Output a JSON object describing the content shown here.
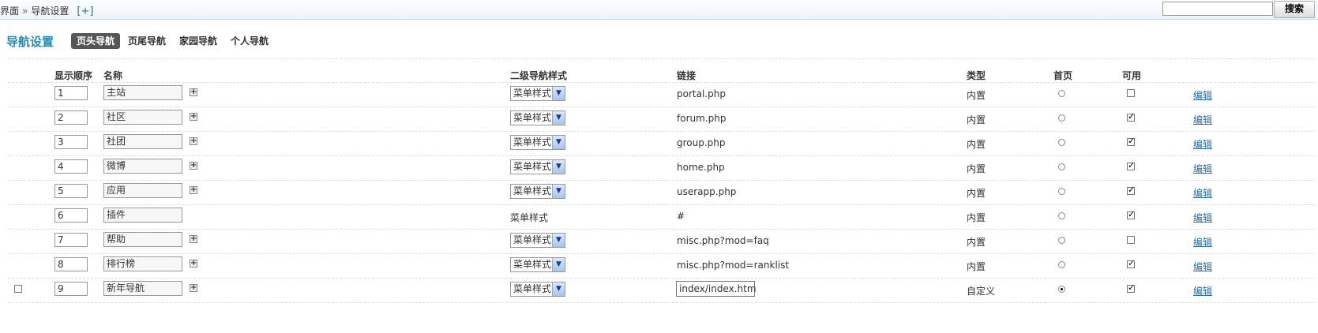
{
  "breadcrumb": {
    "root": "界面",
    "separator": "»",
    "current": "导航设置",
    "add": "[+]"
  },
  "search": {
    "value": "",
    "button": "搜索"
  },
  "page_title": "导航设置",
  "tabs": [
    {
      "label": "页头导航",
      "active": true
    },
    {
      "label": "页尾导航",
      "active": false
    },
    {
      "label": "家园导航",
      "active": false
    },
    {
      "label": "个人导航",
      "active": false
    }
  ],
  "columns": {
    "order": "显示顺序",
    "name": "名称",
    "sub_style": "二级导航样式",
    "link": "链接",
    "type": "类型",
    "home": "首页",
    "available": "可用"
  },
  "rows": [
    {
      "order": "1",
      "name": "主站",
      "style": "菜单样式",
      "style_select": true,
      "link": "portal.php",
      "link_editable": false,
      "type": "内置",
      "home": false,
      "available": false,
      "edit": "编辑",
      "has_row_check": false
    },
    {
      "order": "2",
      "name": "社区",
      "style": "菜单样式",
      "style_select": true,
      "link": "forum.php",
      "link_editable": false,
      "type": "内置",
      "home": false,
      "available": true,
      "edit": "编辑",
      "has_row_check": false
    },
    {
      "order": "3",
      "name": "社团",
      "style": "菜单样式",
      "style_select": true,
      "link": "group.php",
      "link_editable": false,
      "type": "内置",
      "home": false,
      "available": true,
      "edit": "编辑",
      "has_row_check": false
    },
    {
      "order": "4",
      "name": "微博",
      "style": "菜单样式",
      "style_select": true,
      "link": "home.php",
      "link_editable": false,
      "type": "内置",
      "home": false,
      "available": true,
      "edit": "编辑",
      "has_row_check": false
    },
    {
      "order": "5",
      "name": "应用",
      "style": "菜单样式",
      "style_select": true,
      "link": "userapp.php",
      "link_editable": false,
      "type": "内置",
      "home": false,
      "available": true,
      "edit": "编辑",
      "has_row_check": false
    },
    {
      "order": "6",
      "name": "插件",
      "style": "菜单样式",
      "style_select": false,
      "link": "#",
      "link_editable": false,
      "type": "内置",
      "home": false,
      "available": true,
      "edit": "编辑",
      "has_row_check": false
    },
    {
      "order": "7",
      "name": "帮助",
      "style": "菜单样式",
      "style_select": true,
      "link": "misc.php?mod=faq",
      "link_editable": false,
      "type": "内置",
      "home": false,
      "available": false,
      "edit": "编辑",
      "has_row_check": false
    },
    {
      "order": "8",
      "name": "排行榜",
      "style": "菜单样式",
      "style_select": true,
      "link": "misc.php?mod=ranklist",
      "link_editable": false,
      "type": "内置",
      "home": false,
      "available": true,
      "edit": "编辑",
      "has_row_check": false
    },
    {
      "order": "9",
      "name": "新年导航",
      "style": "菜单样式",
      "style_select": true,
      "link": "index/index.htm",
      "link_editable": true,
      "type": "自定义",
      "home": true,
      "available": true,
      "edit": "编辑",
      "has_row_check": true
    }
  ],
  "colors": {
    "accent": "#2a88b0",
    "link": "#2b6f9a",
    "tab_active_bg": "#555555"
  },
  "icons": {
    "add": "plus-box-icon",
    "select_arrow": "chevron-down-icon"
  }
}
